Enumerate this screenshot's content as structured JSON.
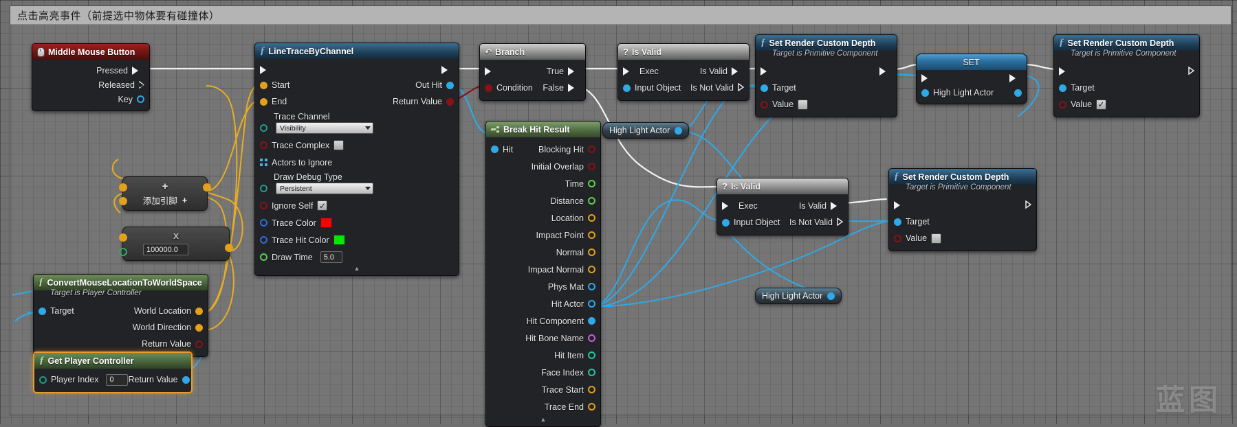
{
  "comment": {
    "title": "点击高亮事件（前提选中物体要有碰撞体）"
  },
  "watermark": "蓝图",
  "colors": {
    "exec_white": "#f2f2f2",
    "object_blue": "#2fa9e8",
    "bool_red": "#8c1018",
    "float_green": "#5cd14b",
    "vector_gold": "#e3a01a",
    "wire_gold": "#e8ad22",
    "string_magenta": "#c45ce0",
    "int_teal": "#1fc7a0",
    "trace_color": "#ff0000",
    "trace_hit_color": "#00e800"
  },
  "nodes": {
    "middle_mouse_button": {
      "title": "Middle Mouse Button",
      "icon": "mouse-icon",
      "outputs": [
        {
          "label": "Pressed",
          "pin": "exec",
          "connected": true
        },
        {
          "label": "Released",
          "pin": "exec",
          "connected": false
        },
        {
          "label": "Key",
          "pin": "dot",
          "color": "#2fa9e8"
        }
      ]
    },
    "line_trace_by_channel": {
      "title": "LineTraceByChannel",
      "icon": "function-icon",
      "inputs": [
        {
          "label": "",
          "pin": "exec"
        },
        {
          "label": "Start",
          "pin": "dot",
          "color": "#e3a01a"
        },
        {
          "label": "End",
          "pin": "dot",
          "color": "#e3a01a"
        },
        {
          "label": "Trace Channel",
          "pin": "ring",
          "color": "#1f9e86",
          "widget": "combo",
          "value": "Visibility"
        },
        {
          "label": "Trace Complex",
          "pin": "ring",
          "color": "#8c1018",
          "widget": "checkbox",
          "checked": false
        },
        {
          "label": "Actors to Ignore",
          "pin": "struct",
          "color": "#2fa9e8"
        },
        {
          "label": "Draw Debug Type",
          "pin": "ring",
          "color": "#1f9e86",
          "widget": "combo",
          "value": "Persistent"
        },
        {
          "label": "Ignore Self",
          "pin": "ring",
          "color": "#8c1018",
          "widget": "checkbox",
          "checked": true
        },
        {
          "label": "Trace Color",
          "pin": "ring",
          "color": "#2a6fd6",
          "widget": "swatch",
          "value": "#ff0000"
        },
        {
          "label": "Trace Hit Color",
          "pin": "ring",
          "color": "#2a6fd6",
          "widget": "swatch",
          "value": "#00e800"
        },
        {
          "label": "Draw Time",
          "pin": "ring",
          "color": "#5cd14b",
          "widget": "number",
          "value": "5.0"
        }
      ],
      "outputs": [
        {
          "label": "",
          "pin": "exec"
        },
        {
          "label": "Out Hit",
          "pin": "dot",
          "color": "#2fa9e8"
        },
        {
          "label": "Return Value",
          "pin": "dot",
          "color": "#8c1018"
        }
      ]
    },
    "branch": {
      "title": "Branch",
      "icon": "branch-icon",
      "inputs": [
        {
          "label": "",
          "pin": "exec"
        },
        {
          "label": "Condition",
          "pin": "dot",
          "color": "#8c1018"
        }
      ],
      "outputs": [
        {
          "label": "True",
          "pin": "exec"
        },
        {
          "label": "False",
          "pin": "exec"
        }
      ]
    },
    "is_valid_1": {
      "title": "Is Valid",
      "icon": "question-icon",
      "inputs": [
        {
          "label": "Exec",
          "pin": "exec"
        },
        {
          "label": "Input Object",
          "pin": "dot",
          "color": "#2fa9e8"
        }
      ],
      "outputs": [
        {
          "label": "Is Valid",
          "pin": "exec",
          "connected": true
        },
        {
          "label": "Is Not Valid",
          "pin": "exec",
          "connected": false
        }
      ]
    },
    "is_valid_2": {
      "title": "Is Valid",
      "icon": "question-icon",
      "inputs": [
        {
          "label": "Exec",
          "pin": "exec"
        },
        {
          "label": "Input Object",
          "pin": "dot",
          "color": "#2fa9e8"
        }
      ],
      "outputs": [
        {
          "label": "Is Valid",
          "pin": "exec",
          "connected": true
        },
        {
          "label": "Is Not Valid",
          "pin": "exec",
          "connected": false
        }
      ]
    },
    "break_hit_result": {
      "title": "Break Hit Result",
      "icon": "break-struct-icon",
      "inputs": [
        {
          "label": "Hit",
          "pin": "dot",
          "color": "#2fa9e8"
        }
      ],
      "outputs": [
        {
          "label": "Blocking Hit",
          "pin": "ring",
          "color": "#8c1018"
        },
        {
          "label": "Initial Overlap",
          "pin": "ring",
          "color": "#8c1018"
        },
        {
          "label": "Time",
          "pin": "ring",
          "color": "#5cd14b"
        },
        {
          "label": "Distance",
          "pin": "ring",
          "color": "#5cd14b"
        },
        {
          "label": "Location",
          "pin": "ring",
          "color": "#e3a01a"
        },
        {
          "label": "Impact Point",
          "pin": "ring",
          "color": "#e3a01a"
        },
        {
          "label": "Normal",
          "pin": "ring",
          "color": "#e3a01a"
        },
        {
          "label": "Impact Normal",
          "pin": "ring",
          "color": "#e3a01a"
        },
        {
          "label": "Phys Mat",
          "pin": "ring",
          "color": "#2fa9e8"
        },
        {
          "label": "Hit Actor",
          "pin": "ring",
          "color": "#2fa9e8"
        },
        {
          "label": "Hit Component",
          "pin": "dot",
          "color": "#2fa9e8"
        },
        {
          "label": "Hit Bone Name",
          "pin": "ring",
          "color": "#c45ce0"
        },
        {
          "label": "Hit Item",
          "pin": "ring",
          "color": "#1fc7a0"
        },
        {
          "label": "Face Index",
          "pin": "ring",
          "color": "#1fc7a0"
        },
        {
          "label": "Trace Start",
          "pin": "ring",
          "color": "#e3a01a"
        },
        {
          "label": "Trace End",
          "pin": "ring",
          "color": "#e3a01a"
        }
      ]
    },
    "set_render_custom_depth_1": {
      "title": "Set Render Custom Depth",
      "subtitle": "Target is Primitive Component",
      "icon": "function-icon",
      "inputs": [
        {
          "label": "",
          "pin": "exec"
        },
        {
          "label": "Target",
          "pin": "dot",
          "color": "#2fa9e8"
        },
        {
          "label": "Value",
          "pin": "ring",
          "color": "#8c1018",
          "widget": "checkbox",
          "checked": false
        }
      ],
      "outputs": [
        {
          "label": "",
          "pin": "exec"
        }
      ]
    },
    "set_render_custom_depth_2": {
      "title": "Set Render Custom Depth",
      "subtitle": "Target is Primitive Component",
      "icon": "function-icon",
      "inputs": [
        {
          "label": "",
          "pin": "exec"
        },
        {
          "label": "Target",
          "pin": "dot",
          "color": "#2fa9e8"
        },
        {
          "label": "Value",
          "pin": "ring",
          "color": "#8c1018",
          "widget": "checkbox",
          "checked": true
        }
      ],
      "outputs": [
        {
          "label": "",
          "pin": "exec",
          "connected": false
        }
      ]
    },
    "set_render_custom_depth_3": {
      "title": "Set Render Custom Depth",
      "subtitle": "Target is Primitive Component",
      "icon": "function-icon",
      "inputs": [
        {
          "label": "",
          "pin": "exec"
        },
        {
          "label": "Target",
          "pin": "dot",
          "color": "#2fa9e8"
        },
        {
          "label": "Value",
          "pin": "ring",
          "color": "#8c1018",
          "widget": "checkbox",
          "checked": false
        }
      ],
      "outputs": [
        {
          "label": "",
          "pin": "exec",
          "connected": false
        }
      ]
    },
    "set_high_light_actor": {
      "title": "SET",
      "variable": "High Light Actor"
    },
    "convert_mouse_location": {
      "title": "ConvertMouseLocationToWorldSpace",
      "subtitle": "Target is Player Controller",
      "icon": "function-icon",
      "inputs": [
        {
          "label": "Target",
          "pin": "dot",
          "color": "#2fa9e8"
        }
      ],
      "outputs": [
        {
          "label": "World Location",
          "pin": "dot",
          "color": "#e3a01a"
        },
        {
          "label": "World Direction",
          "pin": "dot",
          "color": "#e3a01a"
        },
        {
          "label": "Return Value",
          "pin": "ring",
          "color": "#8c1018"
        }
      ]
    },
    "get_player_controller": {
      "title": "Get Player Controller",
      "icon": "function-icon",
      "selected": true,
      "inputs": [
        {
          "label": "Player Index",
          "pin": "ring",
          "color": "#1f9e86",
          "widget": "number",
          "value": "0"
        }
      ],
      "outputs": [
        {
          "label": "Return Value",
          "pin": "dot",
          "color": "#2fa9e8"
        }
      ]
    },
    "add_node": {
      "op": "+",
      "add_pin_label": "添加引脚",
      "add_pin_glyph": "+"
    },
    "multiply_node": {
      "op": "x",
      "value": "100000.0"
    },
    "high_light_actor_get_1": {
      "label": "High Light Actor"
    },
    "high_light_actor_get_2": {
      "label": "High Light Actor"
    }
  }
}
